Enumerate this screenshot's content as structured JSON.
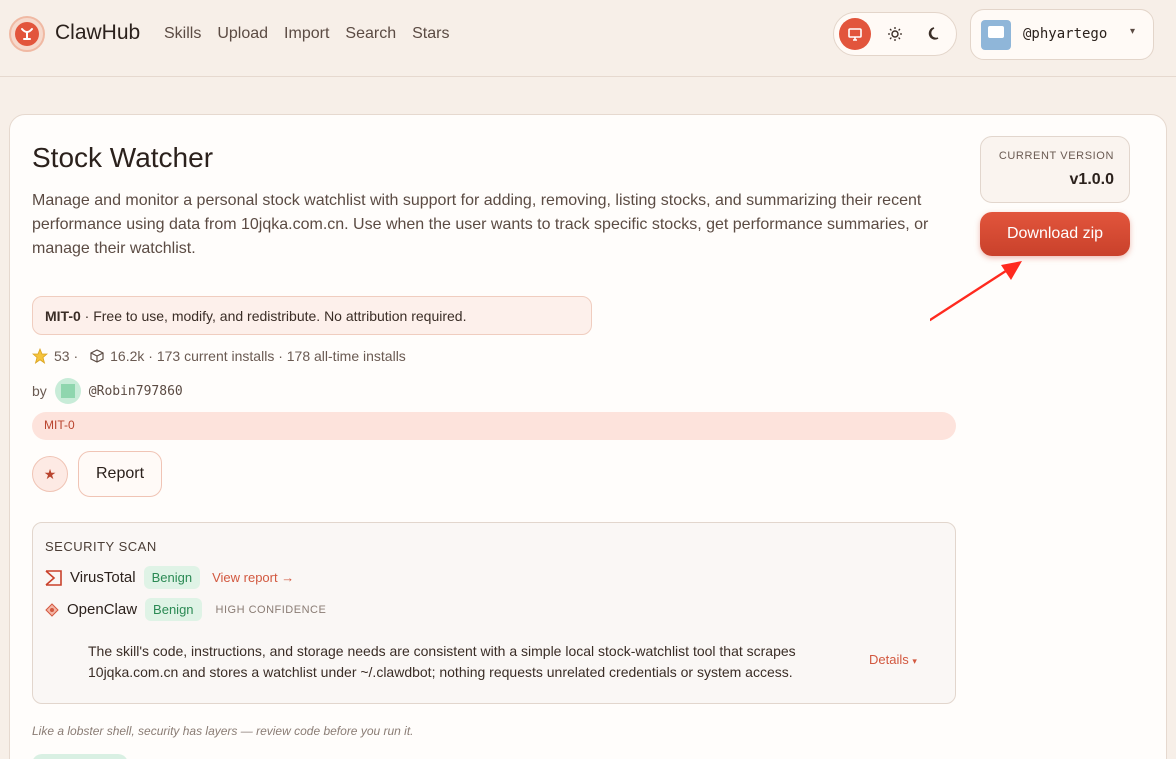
{
  "header": {
    "brand": "ClawHub",
    "nav": [
      "Skills",
      "Upload",
      "Import",
      "Search",
      "Stars"
    ],
    "user": "@phyartego",
    "caret": "▾"
  },
  "skill": {
    "title": "Stock Watcher",
    "description": "Manage and monitor a personal stock watchlist with support for adding, removing, listing stocks, and summarizing their recent performance using data from 10jqka.com.cn. Use when the user wants to track specific stocks, get performance summaries, or manage their watchlist.",
    "license_name": "MIT-0",
    "license_text": " · Free to use, modify, and redistribute. No attribution required.",
    "stars": "53 ·",
    "installs": "16.2k · 173 current installs · 178 all-time installs",
    "by_label": "by",
    "author": "@Robin797860",
    "tag": "MIT-0",
    "report_label": "Report"
  },
  "security": {
    "title": "SECURITY SCAN",
    "virustotal": {
      "name": "VirusTotal",
      "status": "Benign",
      "link": "View report →"
    },
    "openclaw": {
      "name": "OpenClaw",
      "status": "Benign",
      "confidence": "HIGH CONFIDENCE"
    },
    "summary": "The skill's code, instructions, and storage needs are consistent with a simple local stock-watchlist tool that scrapes 10jqka.com.cn and stores a watchlist under ~/.clawdbot; nothing requests unrelated credentials or system access.",
    "details_label": "Details",
    "details_caret": "▾"
  },
  "footnote": "Like a lobster shell, security has layers — review code before you run it.",
  "sidebar": {
    "version_label": "CURRENT VERSION",
    "version": "v1.0.0",
    "download_label": "Download zip"
  },
  "colors": {
    "accent": "#e2553c",
    "benign": "#2b8a54",
    "arrow": "#ff2a1f"
  },
  "icons": [
    "lobster-logo-icon",
    "monitor-icon",
    "sun-icon",
    "moon-icon",
    "star-icon",
    "package-icon",
    "virustotal-icon",
    "openclaw-icon"
  ]
}
